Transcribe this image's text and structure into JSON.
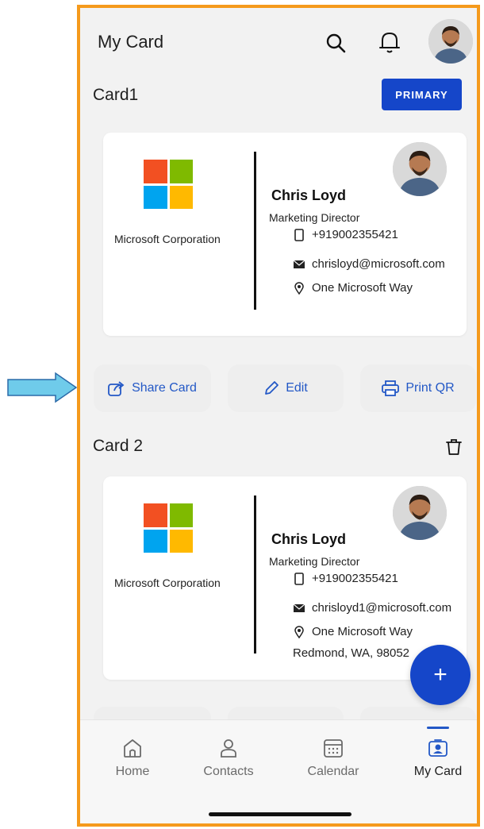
{
  "header": {
    "title": "My Card"
  },
  "cards": [
    {
      "section_title": "Card1",
      "badge": "PRIMARY",
      "company": "Microsoft Corporation",
      "name": "Chris Loyd",
      "role": "Marketing Director",
      "phone": "+919002355421",
      "email": "chrisloyd@microsoft.com",
      "address": "One Microsoft Way",
      "address2": ""
    },
    {
      "section_title": "Card 2",
      "company": "Microsoft Corporation",
      "name": "Chris Loyd",
      "role": "Marketing Director",
      "phone": "+919002355421",
      "email": "chrisloyd1@microsoft.com",
      "address": "One Microsoft Way",
      "address2": "Redmond, WA, 98052"
    }
  ],
  "actions": {
    "share": "Share Card",
    "edit": "Edit",
    "print": "Print QR"
  },
  "fab": {
    "symbol": "+"
  },
  "nav": {
    "home": "Home",
    "contacts": "Contacts",
    "calendar": "Calendar",
    "mycard": "My Card"
  },
  "colors": {
    "accent": "#1546c9",
    "frame": "#f59a1c",
    "ms_red": "#f25022",
    "ms_green": "#7fba00",
    "ms_blue": "#00a4ef",
    "ms_yellow": "#ffb900"
  }
}
